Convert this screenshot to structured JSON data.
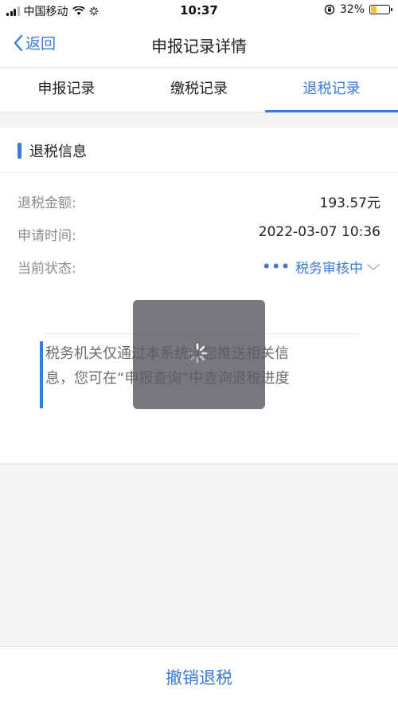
{
  "status_bar": {
    "carrier": "中国移动",
    "time": "10:37",
    "battery_percent": "32%",
    "battery_level": 0.32
  },
  "nav": {
    "back_label": "返回",
    "title": "申报记录详情"
  },
  "tabs": [
    {
      "label": "申报记录",
      "active": false
    },
    {
      "label": "缴税记录",
      "active": false
    },
    {
      "label": "退税记录",
      "active": true
    }
  ],
  "section": {
    "title": "退税信息"
  },
  "fields": {
    "amount": {
      "label": "退税金额:",
      "value": "193.57元"
    },
    "apply_time": {
      "label": "申请时间:",
      "value": "2022-03-07 10:36"
    },
    "status": {
      "label": "当前状态:",
      "value": "税务审核中"
    }
  },
  "notice": {
    "line1": "税务机关仅通过本系统向您推送相关信",
    "line2": "息，您可在“申报查询”中查询退税进度"
  },
  "bottom": {
    "button_label": "撤销退税"
  },
  "colors": {
    "accent": "#3a7bd5",
    "battery": "#f0c419"
  }
}
